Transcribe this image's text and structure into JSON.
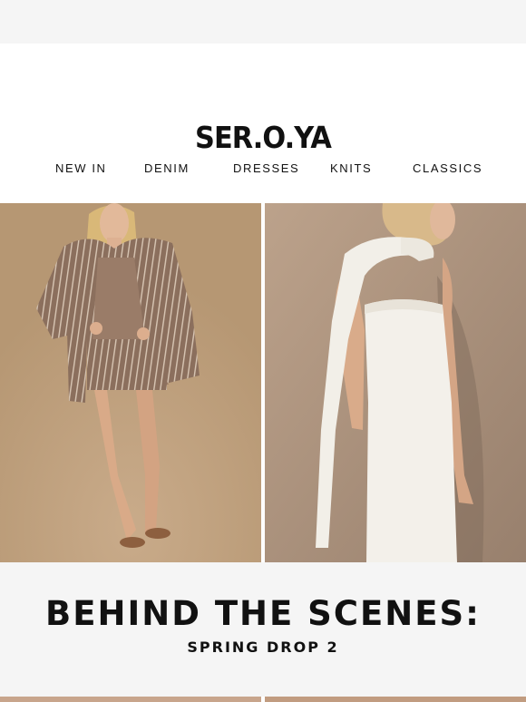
{
  "brand": {
    "logo_text": "SER.O.YA"
  },
  "nav": {
    "items": [
      {
        "label": "NEW IN"
      },
      {
        "label": "DENIM"
      },
      {
        "label": "DRESSES"
      },
      {
        "label": "KNITS"
      },
      {
        "label": "CLASSICS"
      }
    ]
  },
  "hero": {
    "photos": [
      {
        "subject": "model in striped brown blazer and mini skirt"
      },
      {
        "subject": "model in white tweed strapless dress with fringed scarf"
      }
    ]
  },
  "feature": {
    "headline": "BEHIND THE SCENES:",
    "subhead": "SPRING DROP 2"
  },
  "colors": {
    "text": "#111111",
    "background": "#f5f5f5",
    "card": "#ffffff"
  }
}
